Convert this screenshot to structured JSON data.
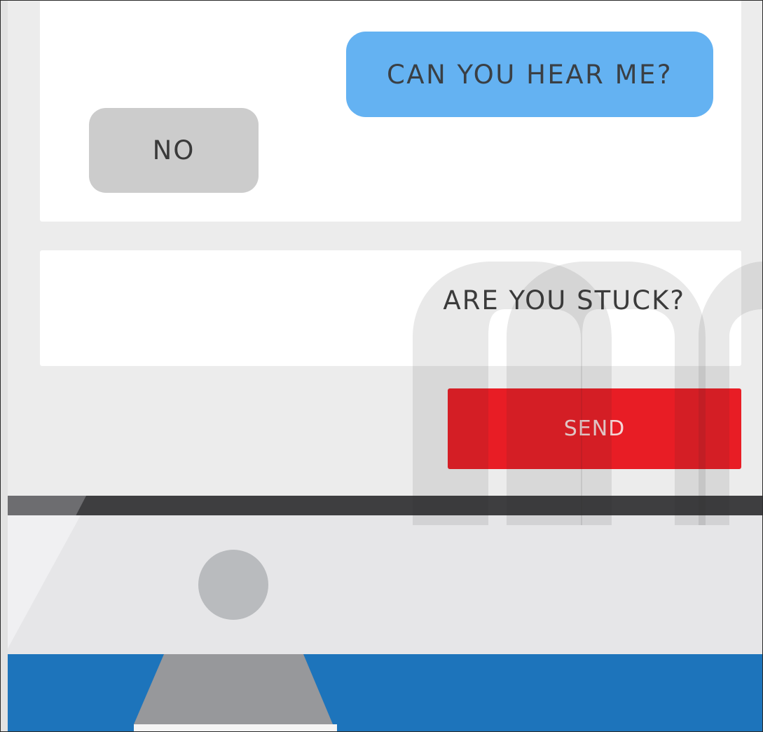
{
  "chat": {
    "sent_message": "CAN YOU HEAR ME?",
    "received_message": "NO"
  },
  "composer": {
    "input_value": "ARE YOU STUCK?",
    "send_label": "SEND"
  },
  "colors": {
    "sent_bubble": "#64b2f2",
    "received_bubble": "#cccccc",
    "send_button": "#e81d25",
    "desk": "#1d74bb",
    "bezel": "#3e3e40"
  },
  "icons": {
    "watermark": "m-logo-watermark-icon",
    "camera": "camera-dot-icon",
    "stand": "monitor-stand-icon"
  }
}
